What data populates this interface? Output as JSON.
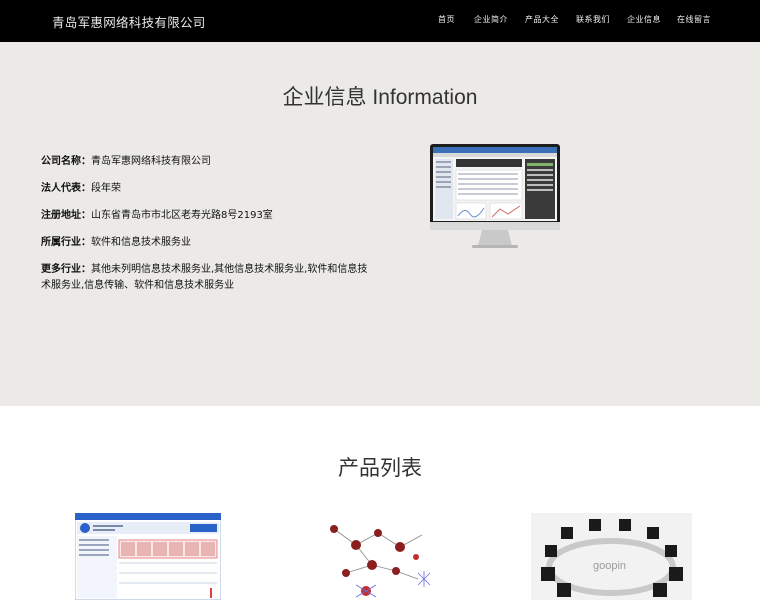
{
  "header": {
    "brand": "青岛军惠网络科技有限公司",
    "nav": [
      {
        "label": "首页"
      },
      {
        "label": "企业简介"
      },
      {
        "label": "产品大全"
      },
      {
        "label": "联系我们"
      },
      {
        "label": "企业信息"
      },
      {
        "label": "在线留言"
      }
    ]
  },
  "info": {
    "title": "企业信息 Information",
    "rows": [
      {
        "label": "公司名称：",
        "value": "青岛军惠网络科技有限公司"
      },
      {
        "label": "法人代表：",
        "value": "段年荣"
      },
      {
        "label": "注册地址：",
        "value": "山东省青岛市市北区老寿光路8号2193室"
      },
      {
        "label": "所属行业：",
        "value": "软件和信息技术服务业"
      },
      {
        "label": "更多行业：",
        "value": "其他未列明信息技术服务业,其他信息技术服务业,软件和信息技术服务业,信息传输、软件和信息技术服务业"
      }
    ]
  },
  "products": {
    "title": "产品列表",
    "thumb3_watermark": "goopin"
  },
  "colors": {
    "header_bg": "#000000",
    "info_bg": "#ebeae6",
    "accent_blue": "#2a62c9"
  }
}
